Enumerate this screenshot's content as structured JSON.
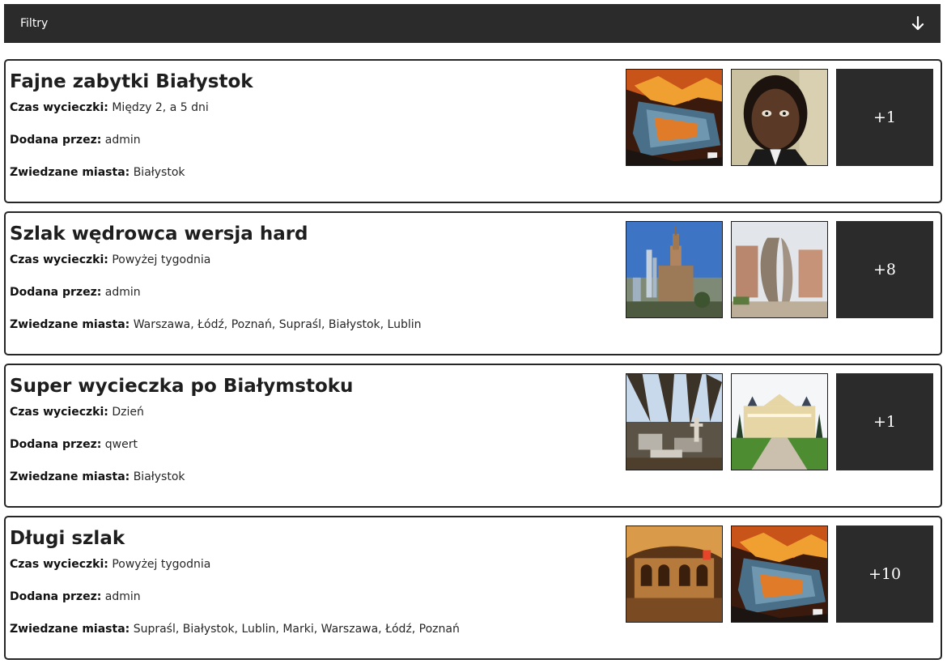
{
  "filters": {
    "label": "Filtry",
    "toggle_icon": "arrow-down-icon"
  },
  "labels": {
    "duration": "Czas wycieczki:",
    "author": "Dodana przez:",
    "cities": "Zwiedzane miasta:"
  },
  "trips": [
    {
      "title": "Fajne zabytki Białystok",
      "duration": "Między 2, a 5 dni",
      "author": "admin",
      "cities": "Białystok",
      "photos": [
        "burning-car-photo",
        "portrait-photo"
      ],
      "more": "+1"
    },
    {
      "title": "Szlak wędrowca wersja hard",
      "duration": "Powyżej tygodnia",
      "author": "admin",
      "cities": "Warszawa, Łódź, Poznań, Supraśl, Białystok, Lublin",
      "photos": [
        "city-palace-photo",
        "sculpture-photo"
      ],
      "more": "+8"
    },
    {
      "title": "Super wycieczka po Białymstoku",
      "duration": "Dzień",
      "author": "qwert",
      "cities": "Białystok",
      "photos": [
        "cemetery-photo",
        "palace-photo"
      ],
      "more": "+1"
    },
    {
      "title": "Długi szlak",
      "duration": "Powyżej tygodnia",
      "author": "admin",
      "cities": "Supraśl, Białystok, Lublin, Marki, Warszawa, Łódź, Poznań",
      "photos": [
        "church-interior-photo",
        "burning-car-photo"
      ],
      "more": "+10"
    }
  ]
}
